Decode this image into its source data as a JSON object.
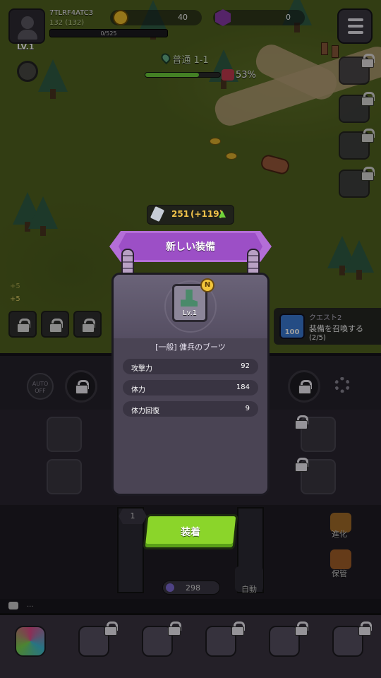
{
  "player": {
    "id": "7TLRF4ATC3",
    "level": "LV.1",
    "power": "132 (132)",
    "xp": "0/525"
  },
  "resources": {
    "gold": "40",
    "gems": "0"
  },
  "stage": {
    "name": "普通 1-1",
    "boss_percent": "53%",
    "progress": 0.72
  },
  "quest": {
    "title": "クエスト2",
    "desc": "装備を召喚する",
    "progress": "(2/5)",
    "badge": "100"
  },
  "buffs": {
    "a": "+5",
    "b": "+5"
  },
  "auto_toggle": "AUTO\nOFF",
  "summon_count": "1",
  "gem_stock": "298",
  "side_labels": {
    "evolve": "進化",
    "storage": "保管",
    "auto": "自動"
  },
  "chat": {
    "text": "..."
  },
  "popup": {
    "power_gain": "251",
    "power_delta": "(+119)",
    "banner": "新しい装備",
    "item_level": "Lv.1",
    "rarity_badge": "N",
    "item_name": "[一般] 傭兵のブーツ",
    "stats": [
      {
        "label": "攻撃力",
        "value": "92"
      },
      {
        "label": "体力",
        "value": "184"
      },
      {
        "label": "体力回復",
        "value": "9"
      }
    ],
    "equip_label": "装着"
  },
  "colors": {
    "equip_button": "#8bd52a",
    "banner": "#9c4fc6",
    "gold_text": "#f0c24a"
  }
}
